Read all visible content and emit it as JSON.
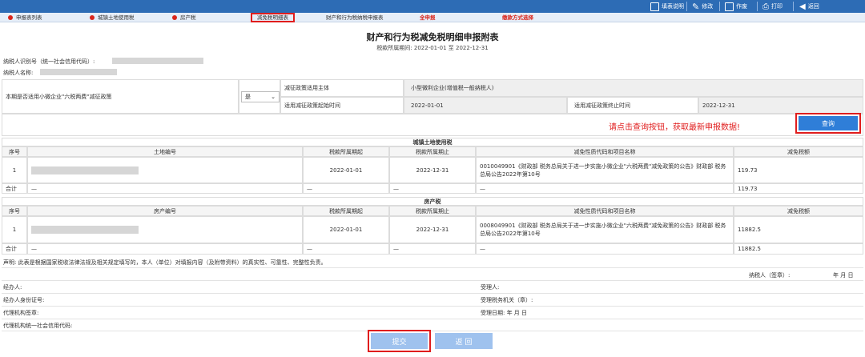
{
  "toolbar": {
    "items": [
      {
        "label": "填表说明",
        "icon": "list-icon"
      },
      {
        "label": "修改",
        "icon": "edit-pen-icon"
      },
      {
        "label": "作废",
        "icon": "void-document-icon"
      },
      {
        "label": "打印",
        "icon": "printer-icon"
      },
      {
        "label": "返回",
        "icon": "back-arrow-icon"
      }
    ]
  },
  "tabs": [
    {
      "label": "申报表列表",
      "dot": true
    },
    {
      "label": "城镇土地使用税",
      "dot": true
    },
    {
      "label": "房产税",
      "dot": true
    },
    {
      "label": "减免税明细表",
      "selected": true
    },
    {
      "label": "财产和行为税纳税申报表"
    },
    {
      "label": "全申报",
      "red": true
    },
    {
      "label": "缴款方式选择",
      "red": true
    }
  ],
  "header": {
    "title": "财产和行为税减免税明细申报附表",
    "period": "税款所属期间:  2022-01-01 至 2022-12-31"
  },
  "taxpayer": {
    "id_label": "纳税人识别号（统一社会信用代码）:",
    "name_label": "纳税人名称:"
  },
  "policy": {
    "question": "本期是否适用小微企业\"六税两费\"减征政策",
    "answer": "是",
    "subject_label": "减征政策适用主体",
    "subject_value": "小型微利企业(增值税一般纳税人)",
    "start_label": "适用减征政策起始时间",
    "start_value": "2022-01-01",
    "end_label": "适用减征政策终止时间",
    "end_value": "2022-12-31"
  },
  "notice": "请点击查询按钮，获取最新申报数据!",
  "query_label": "查询",
  "land": {
    "title": "城镇土地使用税",
    "headers": [
      "序号",
      "土地编号",
      "税款所属期起",
      "税款所属期止",
      "减免性质代码和项目名称",
      "减免税额"
    ],
    "row": {
      "seq": "1",
      "start": "2022-01-01",
      "end": "2022-12-31",
      "code": "0010049901《财政部 税务总局关于进一步实施小微企业\"六税两费\"减免政策的公告》财政部 税务总局公告2022年第10号",
      "amount": "119.73"
    },
    "total": {
      "label": "合计",
      "dash": "—",
      "amount": "119.73"
    }
  },
  "house": {
    "title": "房产税",
    "headers": [
      "序号",
      "房产编号",
      "税款所属期起",
      "税款所属期止",
      "减免性质代码和项目名称",
      "减免税额"
    ],
    "row": {
      "seq": "1",
      "start": "2022-01-01",
      "end": "2022-12-31",
      "code": "0008049901《财政部 税务总局关于进一步实施小微企业\"六税两费\"减免政策的公告》财政部 税务总局公告2022年第10号",
      "amount": "11882.5"
    },
    "total": {
      "label": "合计",
      "dash": "—",
      "amount": "11882.5"
    }
  },
  "declaration": "声明: 此表是根据国家税收法律法规及相关规定填写的，本人（单位）对填报内容（及附带资料）的真实性、可靠性、完整性负责。",
  "signature": {
    "taxpayer_sign": "纳税人（签章）:",
    "date": "年  月  日",
    "agent": "经办人:",
    "agent_id": "经办人身份证号:",
    "agency_sign": "代理机构签章:",
    "agency_code": "代理机构统一社会信用代码:",
    "receiver": "受理人:",
    "tax_office": "受理税务机关（章）:",
    "receive_date": "受理日期:   年  月  日"
  },
  "actions": {
    "submit": "提交",
    "back": "返 回"
  }
}
